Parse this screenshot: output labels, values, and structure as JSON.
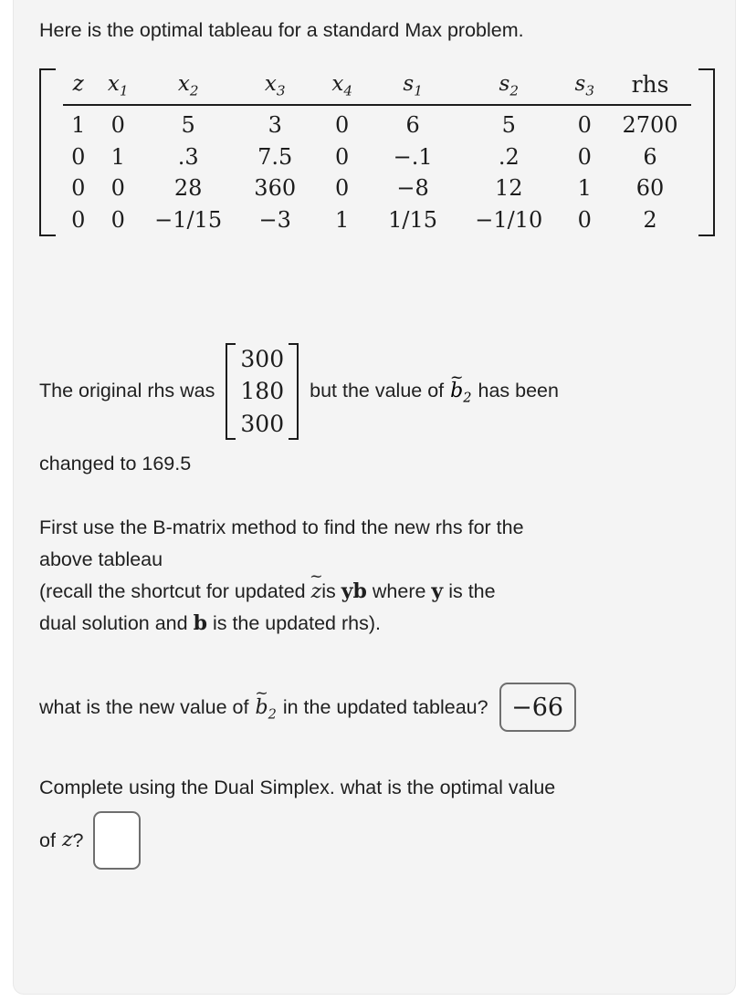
{
  "intro": "Here is the optimal tableau for a standard Max problem.",
  "tableau": {
    "headers": [
      "z",
      "x1",
      "x2",
      "x3",
      "x4",
      "s1",
      "s2",
      "s3",
      "rhs"
    ],
    "header_labels": [
      "z",
      "x",
      "x",
      "x",
      "x",
      "s",
      "s",
      "s",
      "rhs"
    ],
    "header_subs": [
      "",
      "1",
      "2",
      "3",
      "4",
      "1",
      "2",
      "3",
      ""
    ],
    "rows": [
      [
        "1",
        "0",
        "5",
        "3",
        "0",
        "6",
        "5",
        "0",
        "2700"
      ],
      [
        "0",
        "1",
        ".3",
        "7.5",
        "0",
        "−.1",
        ".2",
        "0",
        "6"
      ],
      [
        "0",
        "0",
        "28",
        "360",
        "0",
        "−8",
        "12",
        "1",
        "60"
      ],
      [
        "0",
        "0",
        "−1/15",
        "−3",
        "1",
        "1/15",
        "−1/10",
        "0",
        "2"
      ]
    ]
  },
  "rhs_section": {
    "lead_text": "The original rhs was",
    "vector": [
      "300",
      "180",
      "300"
    ],
    "tail_text_1": "but the value of",
    "b_symbol": "b",
    "b_sub": "2",
    "b_accent": "~",
    "tail_text_2": "has been",
    "changed_line": "changed to 169.5"
  },
  "method": {
    "line1": "First use the B-matrix method to find the new rhs for the",
    "line2": "above tableau",
    "line3_part1": "(recall the shortcut for updated",
    "line3_z": "z",
    "line3_z_accent": "~",
    "line3_part2": "is",
    "line3_y": "y",
    "line3_b": "b",
    "line3_part3": "where",
    "line3_y2": "y",
    "line3_part4": "is the",
    "line4_part1": "dual solution and",
    "line4_b": "b",
    "line4_part2": "is the updated rhs)."
  },
  "question1": {
    "text": "what is the new value of",
    "b_symbol": "b",
    "b_sub": "2",
    "b_accent": "~",
    "text_after": "in the updated tableau?",
    "answer_value": "−66"
  },
  "question2": {
    "line1": "Complete using the Dual Simplex. what is the optimal value",
    "line2_prefix": "of",
    "z_symbol": "z",
    "line2_suffix": "?",
    "answer_value": ""
  },
  "colors": {
    "card_bg": "#f4f4f4",
    "text": "#1f1f1f",
    "math": "#1c1c1c",
    "box_border": "#6e6e6e"
  }
}
